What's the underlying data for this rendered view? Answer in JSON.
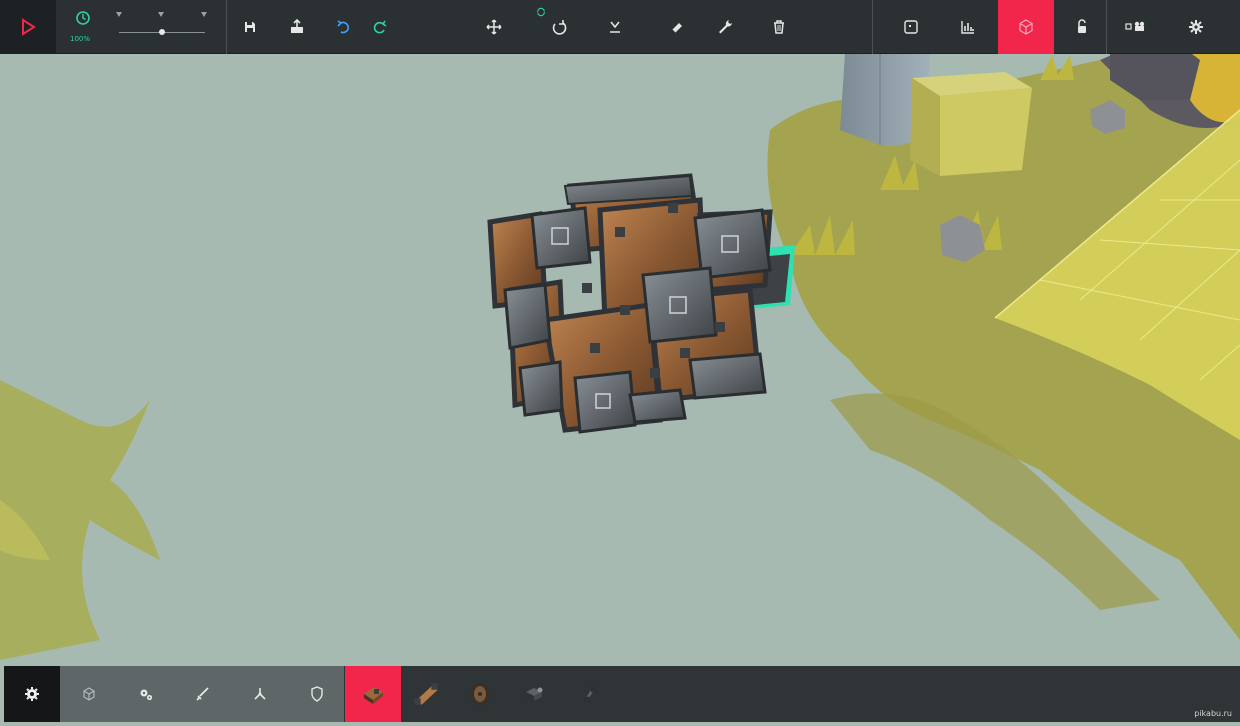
{
  "toolbar": {
    "simulation_speed": "100%",
    "speed_slider_value": 0.5,
    "active_tool": "block-mode-icon"
  },
  "colors": {
    "toolbar_bg": "#2b3032",
    "accent_red": "#f2254a",
    "accent_teal": "#2fd1a6",
    "sky": "#a6bab1",
    "ground_zone": "#d4cf5b",
    "grass": "#a7a63a"
  },
  "icons": {
    "top": [
      "play-icon",
      "speed-clock-icon",
      "save-icon",
      "load-icon",
      "undo-icon",
      "redo-icon",
      "translate-icon",
      "rotate-icon",
      "center-icon",
      "eraser-icon",
      "wrench-icon",
      "trash-icon",
      "map-icon",
      "stats-icon",
      "block-mode-icon",
      "lock-icon",
      "camera-icon",
      "settings-icon"
    ],
    "categories": [
      "gear-cog-icon",
      "cube-icon",
      "gears-icon",
      "sword-icon",
      "propeller-icon",
      "shield-icon"
    ],
    "blocks": [
      "wooden-block-icon",
      "wooden-pole-icon",
      "wheel-icon",
      "steering-icon",
      "hinge-icon"
    ]
  },
  "watermark": "pikabu.ru"
}
